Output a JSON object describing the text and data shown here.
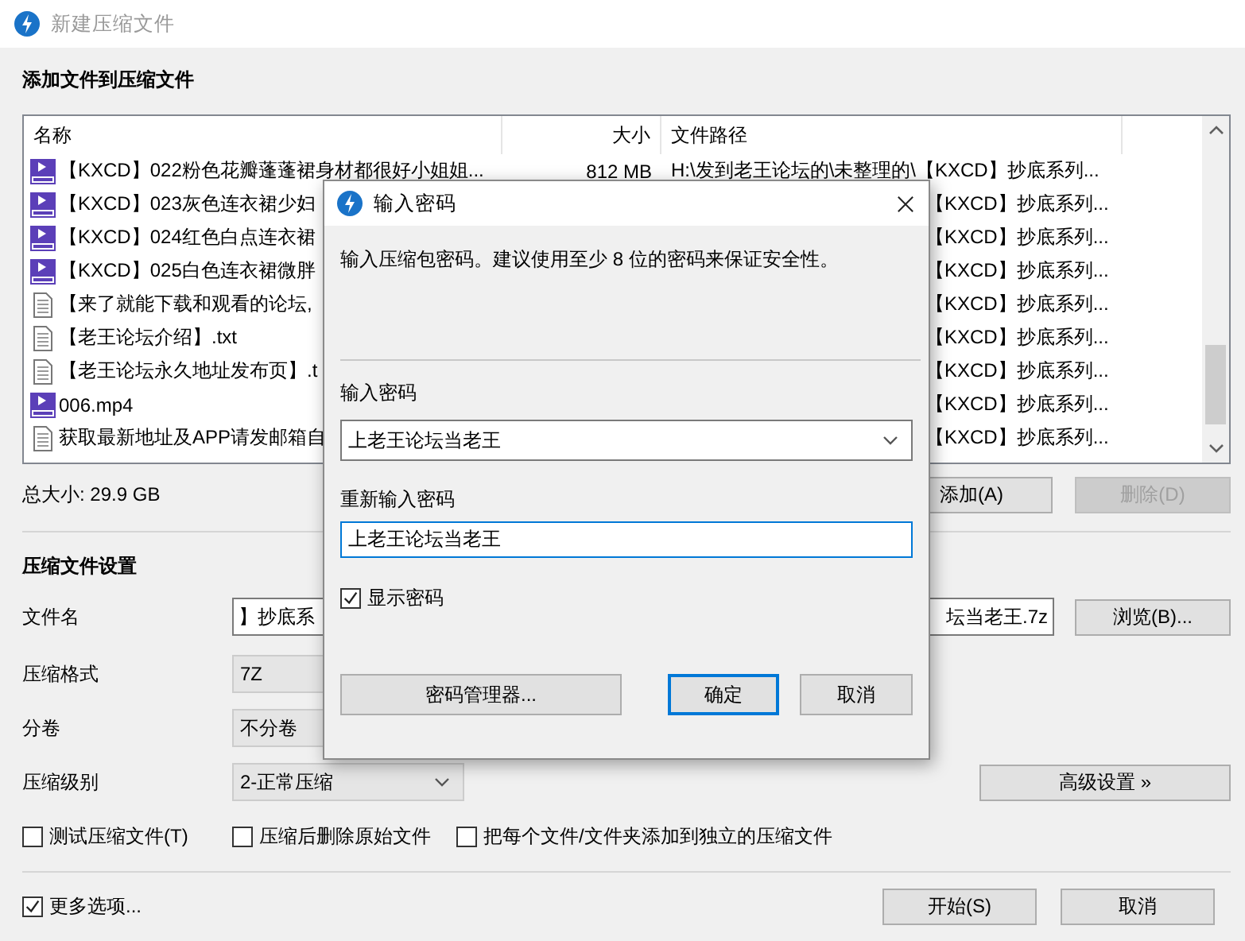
{
  "window": {
    "title": "新建压缩文件"
  },
  "add_section": {
    "heading": "添加文件到压缩文件"
  },
  "file_list": {
    "columns": [
      "名称",
      "大小",
      "文件路径"
    ],
    "rows": [
      {
        "kind": "video",
        "name": "【KXCD】022粉色花瓣蓬蓬裙身材都很好小姐姐...",
        "size": "812 MB",
        "path": "H:\\发到老王论坛的\\未整理的\\【KXCD】抄底系列..."
      },
      {
        "kind": "video",
        "name": "【KXCD】023灰色连衣裙少妇",
        "path": "【KXCD】抄底系列..."
      },
      {
        "kind": "video",
        "name": "【KXCD】024红色白点连衣裙",
        "path": "【KXCD】抄底系列..."
      },
      {
        "kind": "video",
        "name": "【KXCD】025白色连衣裙微胖",
        "path": "【KXCD】抄底系列..."
      },
      {
        "kind": "text",
        "name": "【来了就能下载和观看的论坛,",
        "path": "【KXCD】抄底系列..."
      },
      {
        "kind": "text",
        "name": "【老王论坛介绍】.txt",
        "path": "【KXCD】抄底系列..."
      },
      {
        "kind": "text",
        "name": "【老王论坛永久地址发布页】.t",
        "path": "【KXCD】抄底系列..."
      },
      {
        "kind": "video",
        "name": "006.mp4",
        "path": "【KXCD】抄底系列..."
      },
      {
        "kind": "text",
        "name": "获取最新地址及APP请发邮箱自",
        "path": "【KXCD】抄底系列..."
      }
    ]
  },
  "total_size": "总大小: 29.9 GB",
  "list_buttons": [
    {
      "label": "添加(A)",
      "disabled": false
    },
    {
      "label": "删除(D)",
      "disabled": true
    }
  ],
  "settings": {
    "heading": "压缩文件设置",
    "file_name": {
      "label": "文件名",
      "value_start": "】抄底系",
      "value_end": "坛当老王.7z"
    },
    "browse": "浏览(B)...",
    "format": {
      "label": "压缩格式",
      "value": "7Z"
    },
    "split": {
      "label": "分卷",
      "value": "不分卷"
    },
    "level": {
      "label": "压缩级别",
      "value": "2-正常压缩"
    },
    "advanced": "高级设置 »",
    "options": [
      {
        "label": "测试压缩文件(T)",
        "checked": false
      },
      {
        "label": "压缩后删除原始文件",
        "checked": false
      },
      {
        "label": "把每个文件/文件夹添加到独立的压缩文件",
        "checked": false
      }
    ]
  },
  "more_options": {
    "label": "更多选项...",
    "checked": true
  },
  "footer_buttons": [
    "开始(S)",
    "取消"
  ],
  "dialog": {
    "title": "输入密码",
    "hint": "输入压缩包密码。建议使用至少 8 位的密码来保证安全性。",
    "password": {
      "label": "输入密码",
      "value": "上老王论坛当老王"
    },
    "confirm": {
      "label": "重新输入密码",
      "value": "上老王论坛当老王"
    },
    "show_password": {
      "label": "显示密码",
      "checked": true
    },
    "buttons": [
      {
        "label": "密码管理器...",
        "default": false
      },
      {
        "label": "确定",
        "default": true
      },
      {
        "label": "取消",
        "default": false
      }
    ]
  }
}
